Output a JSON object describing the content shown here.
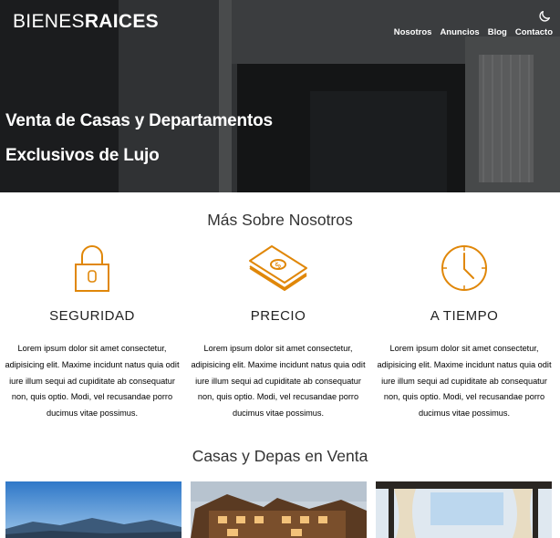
{
  "header": {
    "logo_light": "BIENES",
    "logo_bold": "RAICES",
    "nav": [
      "Nosotros",
      "Anuncios",
      "Blog",
      "Contacto"
    ],
    "dark_mode_icon": "moon-icon"
  },
  "hero": {
    "title_line1": "Venta de Casas y Departamentos",
    "title_line2": "Exclusivos de Lujo"
  },
  "about": {
    "title": "Más Sobre Nosotros",
    "features": [
      {
        "icon": "lock-icon",
        "title": "SEGURIDAD",
        "text": "Lorem ipsum dolor sit amet consectetur, adipisicing elit. Maxime incidunt natus quia odit iure illum sequi ad cupiditate ab consequatur non, quis optio. Modi, vel recusandae porro ducimus vitae possimus."
      },
      {
        "icon": "money-icon",
        "title": "PRECIO",
        "text": "Lorem ipsum dolor sit amet consectetur, adipisicing elit. Maxime incidunt natus quia odit iure illum sequi ad cupiditate ab consequatur non, quis optio. Modi, vel recusandae porro ducimus vitae possimus."
      },
      {
        "icon": "clock-icon",
        "title": "A TIEMPO",
        "text": "Lorem ipsum dolor sit amet consectetur, adipisicing elit. Maxime incidunt natus quia odit iure illum sequi ad cupiditate ab consequatur non, quis optio. Modi, vel recusandae porro ducimus vitae possimus."
      }
    ]
  },
  "listings": {
    "title": "Casas y Depas en Venta"
  },
  "colors": {
    "accent": "#E08709"
  }
}
